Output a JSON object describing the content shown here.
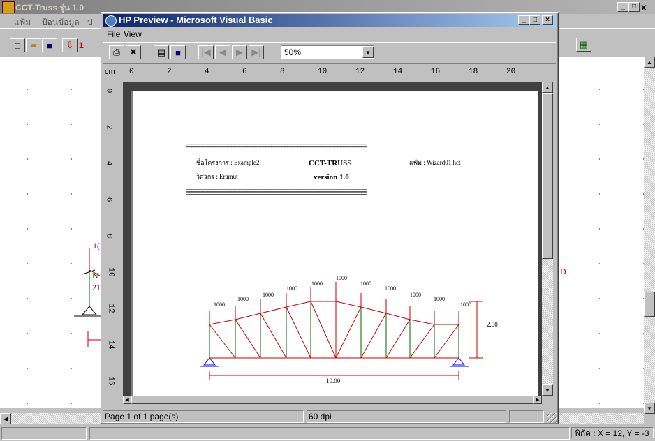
{
  "main_window": {
    "title": "CCT-Truss รุ่น 1.0",
    "menu": [
      "แฟ้ม",
      "ป้อนข้อมูล",
      "ป"
    ],
    "toolbar_fragment": "1",
    "canvas_labels": {
      "l1": "1(",
      "l2": "N",
      "l3": "21",
      "l4": "D"
    },
    "status_coord": "พิกัด : X = 12, Y = -3"
  },
  "preview": {
    "title": "HP Preview - Microsoft Visual Basic",
    "menu": [
      "File",
      "View"
    ],
    "zoom": "50%",
    "ruler_unit": "cm",
    "ruler_h": [
      "0",
      "2",
      "4",
      "6",
      "8",
      "10",
      "12",
      "14",
      "16",
      "18",
      "20"
    ],
    "ruler_v": [
      "0",
      "2",
      "4",
      "6",
      "8",
      "10",
      "12",
      "14",
      "16"
    ],
    "status_page": "Page 1 of 1 page(s)",
    "status_dpi": "60 dpi"
  },
  "page": {
    "rule": "====================================================================",
    "project_label": "ชื่อโครงการ : Example2",
    "engineer_label": "วิศวกร : Eramut",
    "app_name": "CCT-TRUSS",
    "version": "version 1.0",
    "file_label": "แฟ้ม : Wizard01.hct",
    "load_value": "1000",
    "height_dim": "2.00",
    "span_dim": "10.00"
  },
  "colors": {
    "title_active": "#0a246a",
    "title_inactive": "#808080",
    "canvas": "#ffffff",
    "member": "#cc0000",
    "web": "#006600",
    "labels": "#800080"
  }
}
